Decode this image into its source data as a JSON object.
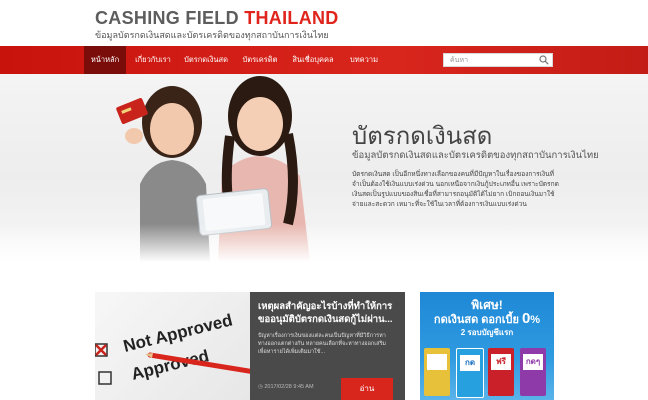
{
  "header": {
    "logo_part1": "CASHING FIELD ",
    "logo_part2": "THAILAND",
    "tagline": "ข้อมูลบัตรกดเงินสดและบัตรเครดิตของทุกสถาบันการเงินไทย"
  },
  "nav": {
    "items": [
      {
        "label": "หน้าหลัก",
        "active": true
      },
      {
        "label": "เกี่ยวกับเรา"
      },
      {
        "label": "บัตรกดเงินสด"
      },
      {
        "label": "บัตรเครดิต"
      },
      {
        "label": "สินเชื่อบุคคล"
      },
      {
        "label": "บทความ"
      }
    ]
  },
  "search": {
    "placeholder": "ค้นหา",
    "icon": "search-icon"
  },
  "hero": {
    "title": "บัตรกดเงินสด",
    "subtitle": "ข้อมูลบัตรกดเงินสดและบัตรเครดิตของทุกสถาบันการเงินไทย",
    "body": "บัตรกดเงินสด เป็นอีกหนึ่งทางเลือกของคนที่มีปัญหาในเรื่องของการเงินที่จำเป็นต้องใช้เงินแบบเร่งด่วน นอกเหนือจากเงินกู้ประเภทอื่น เพราะบัตรกดเงินสดเป็นรูปแบบของสินเชื่อที่สามารถอนุมัติได้ไม่ยาก เบิกถอนเงินมาใช้จ่ายและสะดวก เหมาะที่จะใช้ในเวลาที่ต้องการเงินแบบเร่งด่วน"
  },
  "article": {
    "image_text_1": "Not Approved",
    "image_text_2": "Approved",
    "title": "เหตุผลสำคัญอะไรบ้างที่ทำให้การขออนุมัติบัตรกดเงินสดกู้ไม่ผ่าน...",
    "body": "ปัญหาเรื่องการเงินของแต่ละคนเป็นปัญหาที่มีวิธีการหาทางออกแตกต่างกัน หลายคนเลือกที่จะหาทางออกเสริมเพื่อหารายได้เพิ่มเติมมาใช้...",
    "date": "2017/02/28 9:45 AM",
    "read_label": "อ่าน"
  },
  "promo": {
    "line1": "พิเศษ!",
    "line2_prefix": "กดเงินสด ดอกเบี้ย ",
    "line2_value": "0",
    "line2_suffix": "%",
    "line3": "2 รอบบัญชีแรก",
    "atms": [
      {
        "label": "",
        "color": "#e8c13a"
      },
      {
        "label": "กด",
        "color": "#27a0e0"
      },
      {
        "label": "ฟรี",
        "color": "#c9202a"
      },
      {
        "label": "กดๆ",
        "color": "#8e3aa8"
      }
    ]
  }
}
